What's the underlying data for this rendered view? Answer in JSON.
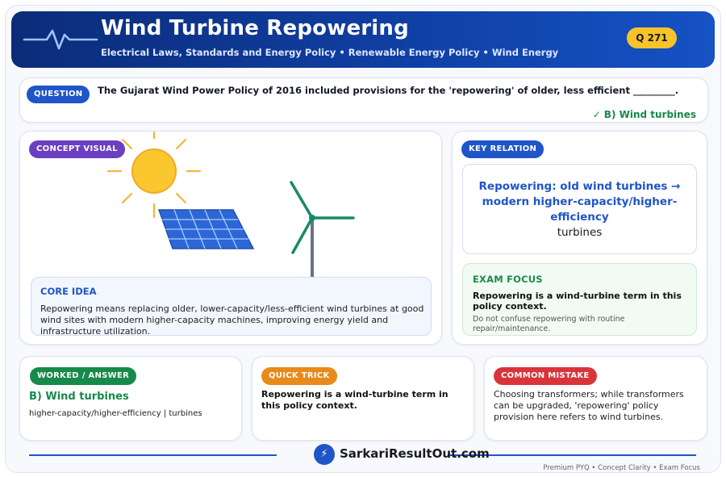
{
  "header": {
    "title": "Wind Turbine Repowering",
    "subtitle": "Electrical Laws, Standards and Energy Policy  •  Renewable Energy Policy  •  Wind Energy",
    "badge": "Q 271"
  },
  "question": {
    "label": "QUESTION",
    "text": "The Gujarat Wind Power Policy of 2016 included provisions for the 'repowering' of older, less efficient _________.",
    "answer": "✓ B) Wind turbines"
  },
  "concept": {
    "label": "CONCEPT VISUAL",
    "icons": [
      "sun-icon",
      "solar-panel-icon",
      "wind-turbine-icon"
    ],
    "core_heading": "CORE IDEA",
    "core_text": "Repowering means replacing older, lower-capacity/less-efficient wind turbines at good wind sites with modern higher-capacity machines, improving energy yield and infrastructure utilization."
  },
  "key_relation": {
    "label": "KEY RELATION",
    "relation_bold": "Repowering: old wind turbines → modern higher-capacity/higher-efficiency",
    "relation_normal": "turbines",
    "focus_heading": "EXAM FOCUS",
    "focus_text": "Repowering is a wind-turbine term in this policy context.",
    "focus_note": "Do not confuse repowering with routine repair/maintenance."
  },
  "worked": {
    "label": "WORKED / ANSWER",
    "answer": "B) Wind turbines",
    "detail": "higher-capacity/higher-efficiency | turbines"
  },
  "trick": {
    "label": "QUICK TRICK",
    "text": "Repowering is a wind-turbine term in this policy context."
  },
  "mistake": {
    "label": "COMMON MISTAKE",
    "text": "Choosing transformers; while transformers can be upgraded, 'repowering' policy provision here refers to wind turbines."
  },
  "footer": {
    "brand": "SarkariResultOut.com",
    "tagline": "Premium PYQ • Concept Clarity • Exam Focus"
  },
  "colors": {
    "header_bg": "#103fa3",
    "accent_blue": "#1f55c8",
    "answer_green": "#168a4a",
    "badge_yellow": "#f6c32b",
    "concept_purple": "#6a3fc1",
    "trick_orange": "#e88a1a",
    "mistake_red": "#d9343a"
  }
}
